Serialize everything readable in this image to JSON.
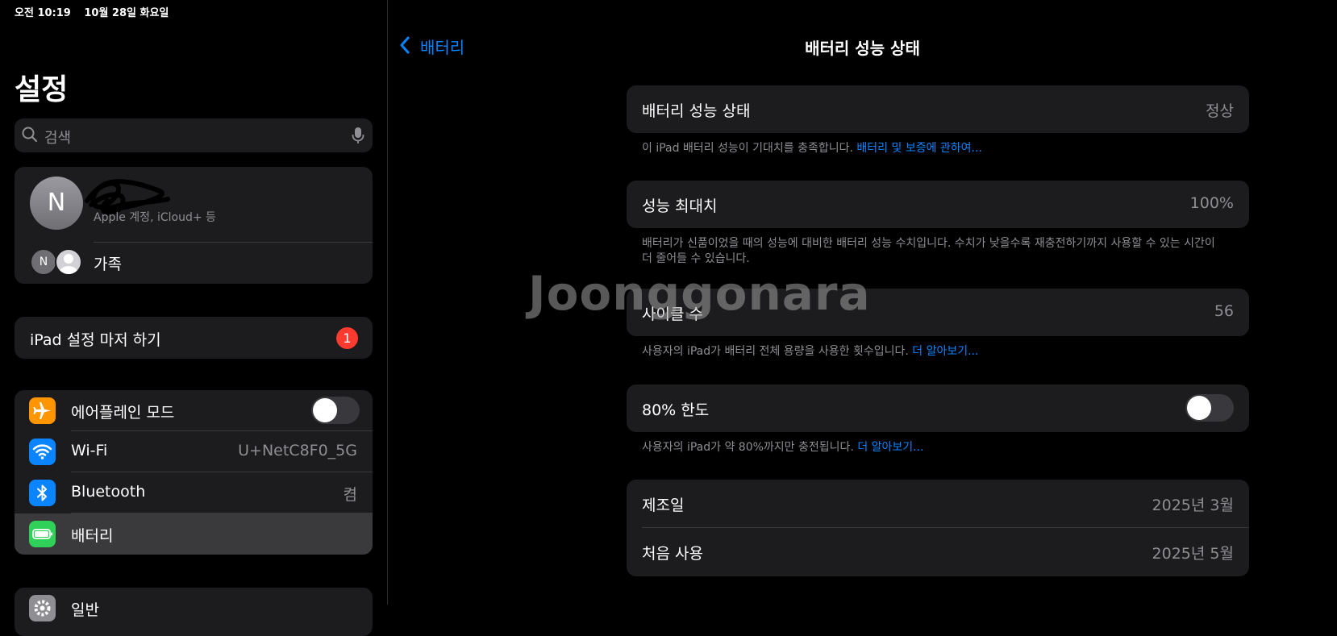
{
  "status_bar": {
    "time": "오전 10:19",
    "date": "10월 28일 화요일"
  },
  "sidebar": {
    "title": "설정",
    "search": {
      "placeholder": "검색"
    },
    "account": {
      "avatar_initial": "N",
      "subtitle": "Apple 계정, iCloud+ 등",
      "family_initial": "N",
      "family_label": "가족"
    },
    "setup": {
      "label": "iPad 설정 마저 하기",
      "badge": "1"
    },
    "items": [
      {
        "label": "에어플레인 모드",
        "icon": "airplane-icon",
        "value": "",
        "toggle": false
      },
      {
        "label": "Wi-Fi",
        "icon": "wifi-icon",
        "value": "U+NetC8F0_5G"
      },
      {
        "label": "Bluetooth",
        "icon": "bluetooth-icon",
        "value": "켬"
      },
      {
        "label": "배터리",
        "icon": "battery-icon",
        "value": "",
        "selected": true
      },
      {
        "label": "일반",
        "icon": "gear-icon",
        "value": ""
      }
    ]
  },
  "detail": {
    "back_label": "배터리",
    "title": "배터리 성능 상태",
    "health": {
      "label": "배터리 성능 상태",
      "value": "정상",
      "footer": "이 iPad 배터리 성능이 기대치를 충족합니다.",
      "link": "배터리 및 보증에 관하여..."
    },
    "max_capacity": {
      "label": "성능 최대치",
      "value": "100%",
      "footer": "배터리가 신품이었을 때의 성능에 대비한 배터리 성능 수치입니다. 수치가 낮을수록 재충전하기까지 사용할 수 있는 시간이 더 줄어들 수 있습니다."
    },
    "cycle_count": {
      "label": "사이클 수",
      "value": "56",
      "footer": "사용자의 iPad가 배터리 전체 용량을 사용한 횟수입니다.",
      "link": "더 알아보기..."
    },
    "limit": {
      "label": "80% 한도",
      "on": false,
      "footer": "사용자의 iPad가 약 80%까지만 충전됩니다.",
      "link": "더 알아보기..."
    },
    "manufacture": {
      "label": "제조일",
      "value": "2025년 3월"
    },
    "first_use": {
      "label": "처음 사용",
      "value": "2025년 5월"
    }
  },
  "watermark": "Joonggonara",
  "colors": {
    "accent": "#0a84ff",
    "badge": "#ff3b30",
    "airplane": "#ff9500",
    "wifi": "#0a84ff",
    "bluetooth": "#0a84ff",
    "battery": "#30d158",
    "gear": "#8e8e93"
  }
}
